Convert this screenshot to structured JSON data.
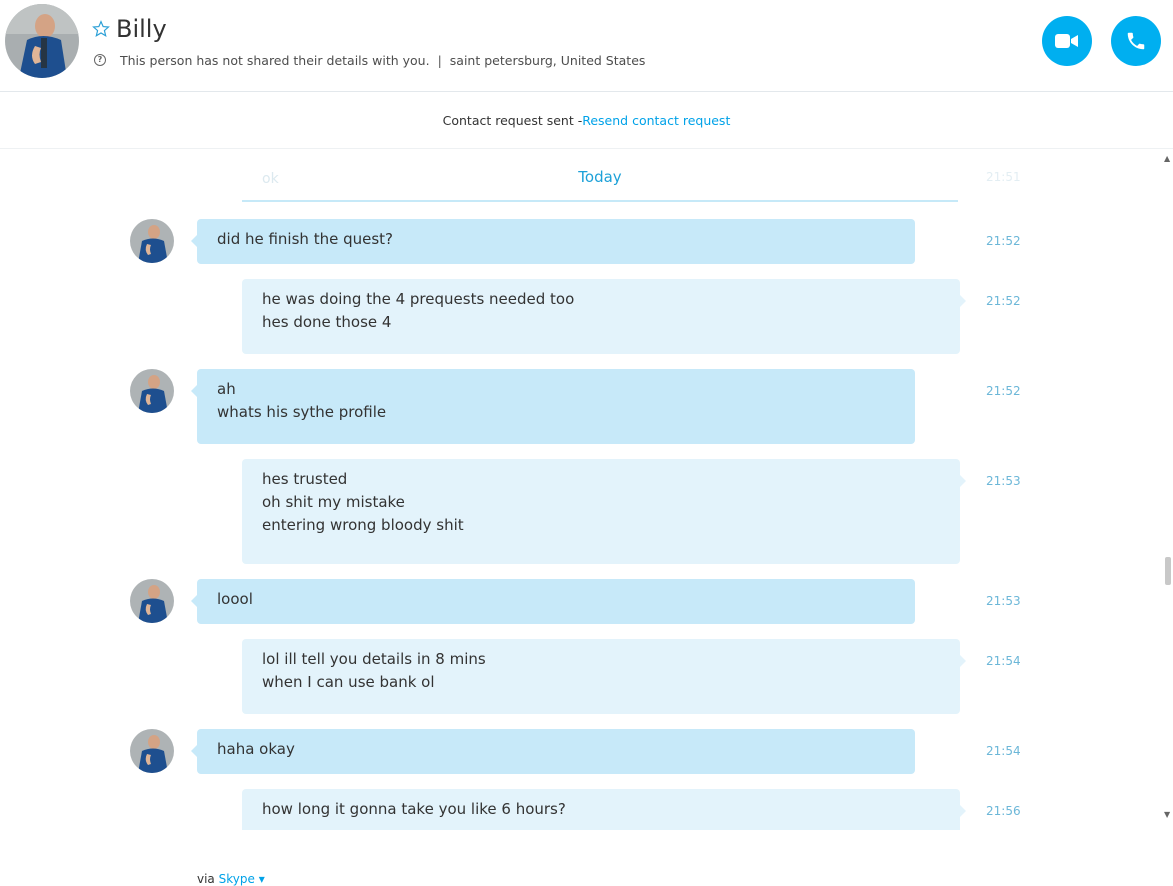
{
  "header": {
    "contact_name": "Billy",
    "info_text": "This person has not shared their details with you.",
    "separator": "|",
    "location": "saint petersburg, United States"
  },
  "request_bar": {
    "status_text": "Contact request sent - ",
    "resend_link": "Resend contact request"
  },
  "chat": {
    "ghost_text": "ok",
    "ghost_time": "21:51",
    "date_divider": "Today",
    "messages": [
      {
        "sender": "Billy",
        "lines": [
          "did he finish the quest?"
        ],
        "time": "21:52"
      },
      {
        "sender": "me",
        "lines": [
          "he was doing the 4 prequests needed too",
          "hes done those 4"
        ],
        "time": "21:52"
      },
      {
        "sender": "Billy",
        "lines": [
          "ah",
          "whats his sythe profile"
        ],
        "time": "21:52"
      },
      {
        "sender": "me",
        "lines": [
          "hes trusted",
          "oh shit my mistake",
          "entering wrong bloody shit"
        ],
        "time": "21:53"
      },
      {
        "sender": "Billy",
        "lines": [
          "loool"
        ],
        "time": "21:53"
      },
      {
        "sender": "me",
        "lines": [
          "lol ill tell you details in 8 mins",
          "when I can use bank ol"
        ],
        "time": "21:54"
      },
      {
        "sender": "Billy",
        "lines": [
          "haha okay"
        ],
        "time": "21:54"
      },
      {
        "sender": "me",
        "lines": [
          "how long it gonna take you like 6 hours?"
        ],
        "time": "21:56"
      }
    ]
  },
  "footer": {
    "via_text": "via ",
    "service_link": "Skype",
    "dropdown_glyph": "▾"
  },
  "colors": {
    "accent": "#00aff0",
    "incoming_bubble": "#c7e9f9",
    "outgoing_bubble": "#e3f3fb",
    "link": "#00a2e8",
    "timestamp": "#6cb7d8"
  },
  "icons": {
    "favorite": "star-outline-icon",
    "info": "question-circle-icon",
    "video_call": "video-camera-icon",
    "voice_call": "phone-icon"
  }
}
